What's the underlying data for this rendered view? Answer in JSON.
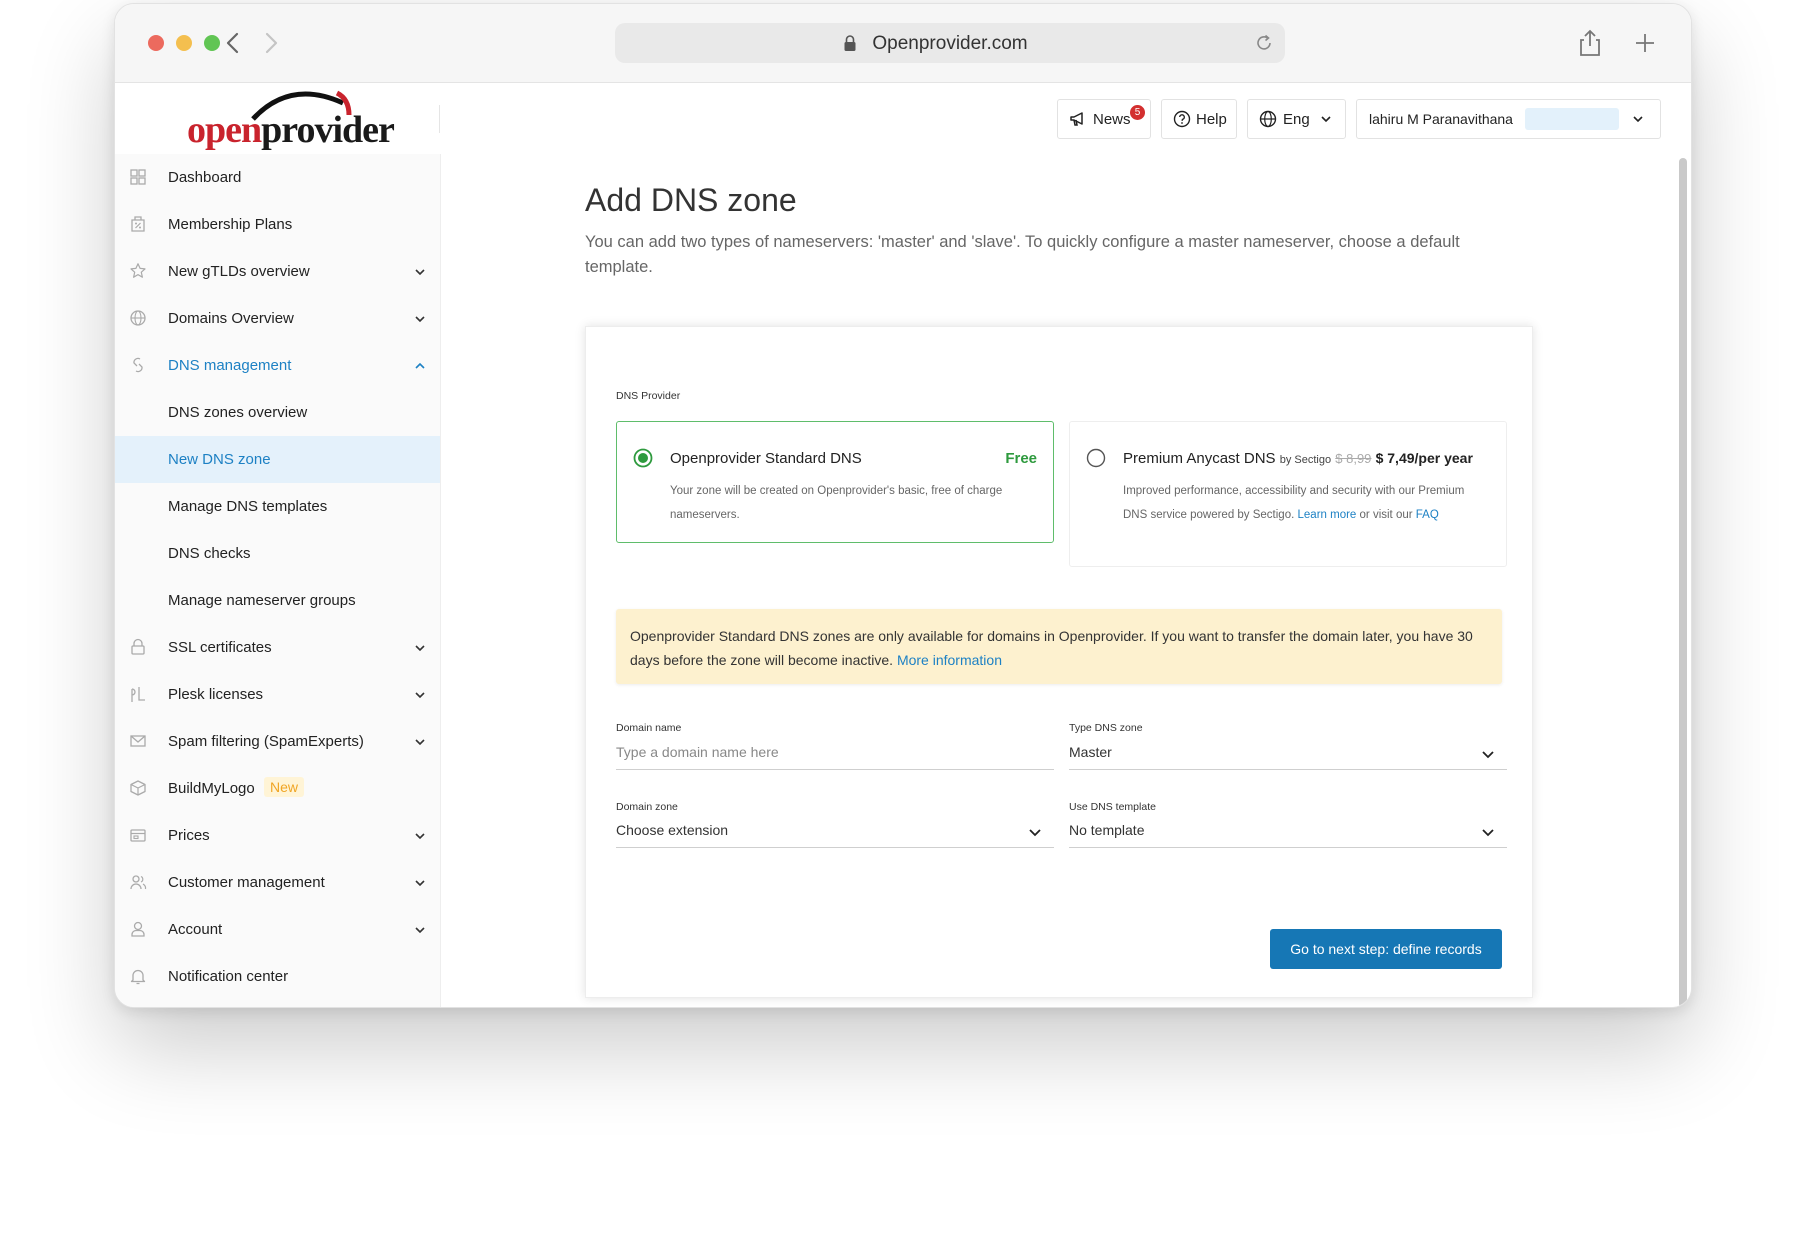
{
  "browser": {
    "url": "Openprovider.com"
  },
  "header": {
    "news_label": "News",
    "news_count": "5",
    "help_label": "Help",
    "lang_label": "Eng",
    "user_name": "lahiru M Paranavithana"
  },
  "logo": {
    "text_part1": "open",
    "text_part2": "provider"
  },
  "sidebar": {
    "items": [
      {
        "label": "Dashboard",
        "icon": "dashboard-icon"
      },
      {
        "label": "Membership Plans",
        "icon": "membership-icon"
      },
      {
        "label": "New gTLDs overview",
        "icon": "star-icon"
      },
      {
        "label": "Domains Overview",
        "icon": "globe-icon"
      },
      {
        "label": "DNS management",
        "icon": "dns-icon"
      },
      {
        "label": "DNS zones overview"
      },
      {
        "label": "New DNS zone"
      },
      {
        "label": "Manage DNS templates"
      },
      {
        "label": "DNS checks"
      },
      {
        "label": "Manage nameserver groups"
      },
      {
        "label": "SSL certificates",
        "icon": "lock-icon"
      },
      {
        "label": "Plesk licenses",
        "icon": "plesk-icon"
      },
      {
        "label": "Spam filtering (SpamExperts)",
        "icon": "mail-icon"
      },
      {
        "label": "BuildMyLogo",
        "icon": "box-icon",
        "badge": "New"
      },
      {
        "label": "Prices",
        "icon": "prices-icon"
      },
      {
        "label": "Customer management",
        "icon": "customers-icon"
      },
      {
        "label": "Account",
        "icon": "user-icon"
      },
      {
        "label": "Notification center",
        "icon": "bell-icon"
      }
    ]
  },
  "main": {
    "title": "Add DNS zone",
    "description": "You can add two types of nameservers: 'master' and 'slave'. To quickly configure a master nameserver, choose a default template.",
    "provider_label": "DNS Provider",
    "options": {
      "standard": {
        "title": "Openprovider Standard DNS",
        "price": "Free",
        "description": "Your zone will be created on Openprovider's basic, free of charge nameservers."
      },
      "premium": {
        "title": "Premium Anycast DNS",
        "by": "by Sectigo",
        "old_price": "$ 8,99",
        "price": "$ 7,49/per year",
        "desc_1": "Improved performance, accessibility and security with our Premium DNS service powered by Sectigo.",
        "learn_more": "Learn more",
        "desc_2": "or visit our",
        "faq": "FAQ"
      }
    },
    "warning": {
      "text": "Openprovider Standard DNS zones are only available for domains in Openprovider. If you want to transfer the domain later, you have 30 days before the zone will become inactive.",
      "link": "More information"
    },
    "fields": {
      "domain_name": {
        "label": "Domain name",
        "placeholder": "Type a domain name here"
      },
      "type_zone": {
        "label": "Type DNS zone",
        "value": "Master"
      },
      "domain_zone": {
        "label": "Domain zone",
        "value": "Choose extension"
      },
      "dns_template": {
        "label": "Use DNS template",
        "value": "No template"
      }
    },
    "submit_label": "Go to next step: define records"
  },
  "colors": {
    "accent": "#1d81c4",
    "button": "#1677b5",
    "selected_border": "#5fbd6b",
    "warning_bg": "#fdf1cf",
    "logo_red": "#c9232d"
  }
}
